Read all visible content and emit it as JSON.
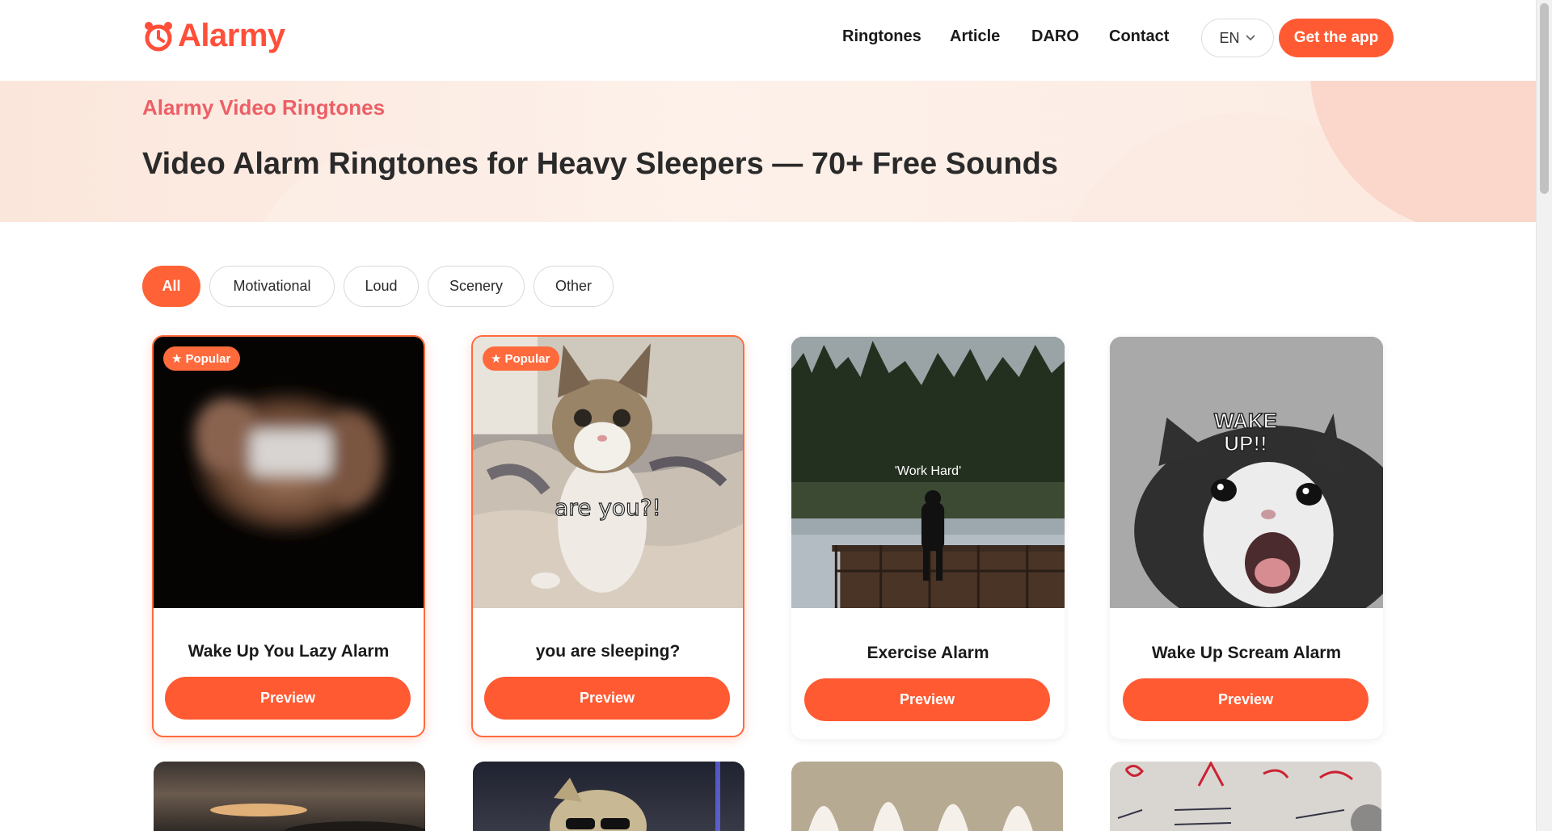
{
  "header": {
    "logo_text": "Alarmy",
    "nav": [
      "Ringtones",
      "Article",
      "DARO",
      "Contact"
    ],
    "lang": "EN",
    "cta": "Get the app"
  },
  "hero": {
    "kicker": "Alarmy Video Ringtones",
    "title": "Video Alarm Ringtones for Heavy Sleepers — 70+ Free Sounds"
  },
  "filters": [
    "All",
    "Motivational",
    "Loud",
    "Scenery",
    "Other"
  ],
  "active_filter": "All",
  "cards": [
    {
      "title": "Wake Up You Lazy Alarm",
      "badge": "Popular",
      "button": "Preview",
      "thumb_caption": ""
    },
    {
      "title": "you are sleeping?",
      "badge": "Popular",
      "button": "Preview",
      "thumb_caption": "are you?!"
    },
    {
      "title": "Exercise Alarm",
      "badge": "",
      "button": "Preview",
      "thumb_caption": "'Work Hard'"
    },
    {
      "title": "Wake Up Scream Alarm",
      "badge": "",
      "button": "Preview",
      "thumb_caption": "WAKE UP!!"
    }
  ],
  "colors": {
    "brand": "#ff5a32",
    "kicker": "#ec5f66",
    "hero_bg": "#fcebe2"
  }
}
